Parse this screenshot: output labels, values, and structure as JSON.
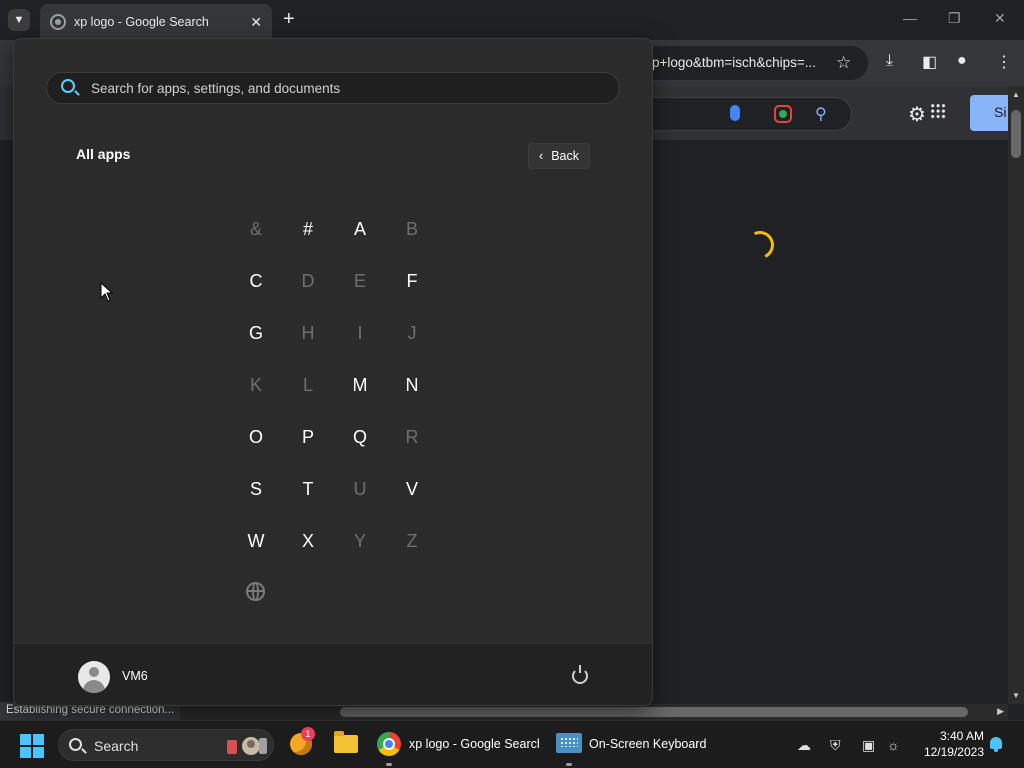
{
  "browser": {
    "tab_title": "xp logo - Google Search",
    "address_text": "p+logo&tbm=isch&chips=...",
    "status_text": "Establishing secure connection...",
    "signin_label": "Si"
  },
  "start_menu": {
    "search_placeholder": "Search for apps, settings, and documents",
    "section_title": "All apps",
    "back_label": "Back",
    "letters": [
      {
        "char": "&",
        "enabled": false
      },
      {
        "char": "#",
        "enabled": true
      },
      {
        "char": "A",
        "enabled": true
      },
      {
        "char": "B",
        "enabled": false
      },
      {
        "char": "C",
        "enabled": true
      },
      {
        "char": "D",
        "enabled": false
      },
      {
        "char": "E",
        "enabled": false
      },
      {
        "char": "F",
        "enabled": true
      },
      {
        "char": "G",
        "enabled": true
      },
      {
        "char": "H",
        "enabled": false
      },
      {
        "char": "I",
        "enabled": false
      },
      {
        "char": "J",
        "enabled": false
      },
      {
        "char": "K",
        "enabled": false
      },
      {
        "char": "L",
        "enabled": false
      },
      {
        "char": "M",
        "enabled": true
      },
      {
        "char": "N",
        "enabled": true
      },
      {
        "char": "O",
        "enabled": true
      },
      {
        "char": "P",
        "enabled": true
      },
      {
        "char": "Q",
        "enabled": true
      },
      {
        "char": "R",
        "enabled": false
      },
      {
        "char": "S",
        "enabled": true
      },
      {
        "char": "T",
        "enabled": true
      },
      {
        "char": "U",
        "enabled": false
      },
      {
        "char": "V",
        "enabled": true
      },
      {
        "char": "W",
        "enabled": true
      },
      {
        "char": "X",
        "enabled": true
      },
      {
        "char": "Y",
        "enabled": false
      },
      {
        "char": "Z",
        "enabled": false
      }
    ],
    "user_name": "VM6"
  },
  "taskbar": {
    "search_label": "Search",
    "notification_count": "1",
    "chrome_label": "xp logo - Google Search",
    "keyboard_label": "On-Screen Keyboard",
    "time": "3:40 AM",
    "date": "12/19/2023"
  },
  "colors": {
    "accent": "#60cdff",
    "spinner": "#fbbc04",
    "signin_bg": "#8ab4f8"
  }
}
